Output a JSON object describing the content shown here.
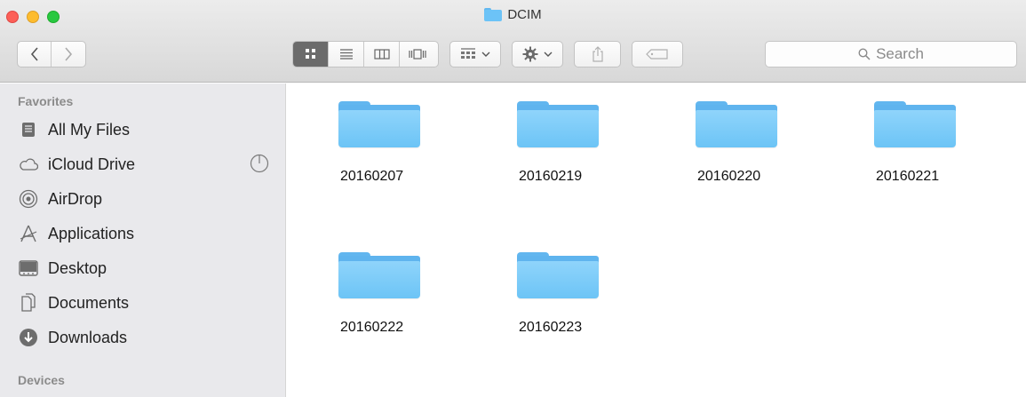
{
  "window": {
    "title": "DCIM"
  },
  "toolbar": {
    "back_icon": "chevron-left-icon",
    "forward_icon": "chevron-right-icon",
    "view_modes": [
      "icon-view",
      "list-view",
      "column-view",
      "cover-flow-view"
    ],
    "active_view": "icon-view",
    "search_placeholder": "Search"
  },
  "sidebar": {
    "favorites_heading": "Favorites",
    "items": [
      {
        "label": "All My Files",
        "icon": "all-files-icon"
      },
      {
        "label": "iCloud Drive",
        "icon": "cloud-icon"
      },
      {
        "label": "AirDrop",
        "icon": "airdrop-icon"
      },
      {
        "label": "Applications",
        "icon": "applications-icon"
      },
      {
        "label": "Desktop",
        "icon": "desktop-icon"
      },
      {
        "label": "Documents",
        "icon": "documents-icon"
      },
      {
        "label": "Downloads",
        "icon": "downloads-icon"
      }
    ],
    "devices_heading": "Devices"
  },
  "files": [
    {
      "name": "20160207"
    },
    {
      "name": "20160219"
    },
    {
      "name": "20160220"
    },
    {
      "name": "20160221"
    },
    {
      "name": "20160222"
    },
    {
      "name": "20160223"
    }
  ],
  "colors": {
    "folder": "#6cc4f6",
    "sidebar_bg": "#e9e9ec",
    "close": "#fc5f57",
    "minimize": "#fdbc2e",
    "maximize": "#28c840"
  }
}
